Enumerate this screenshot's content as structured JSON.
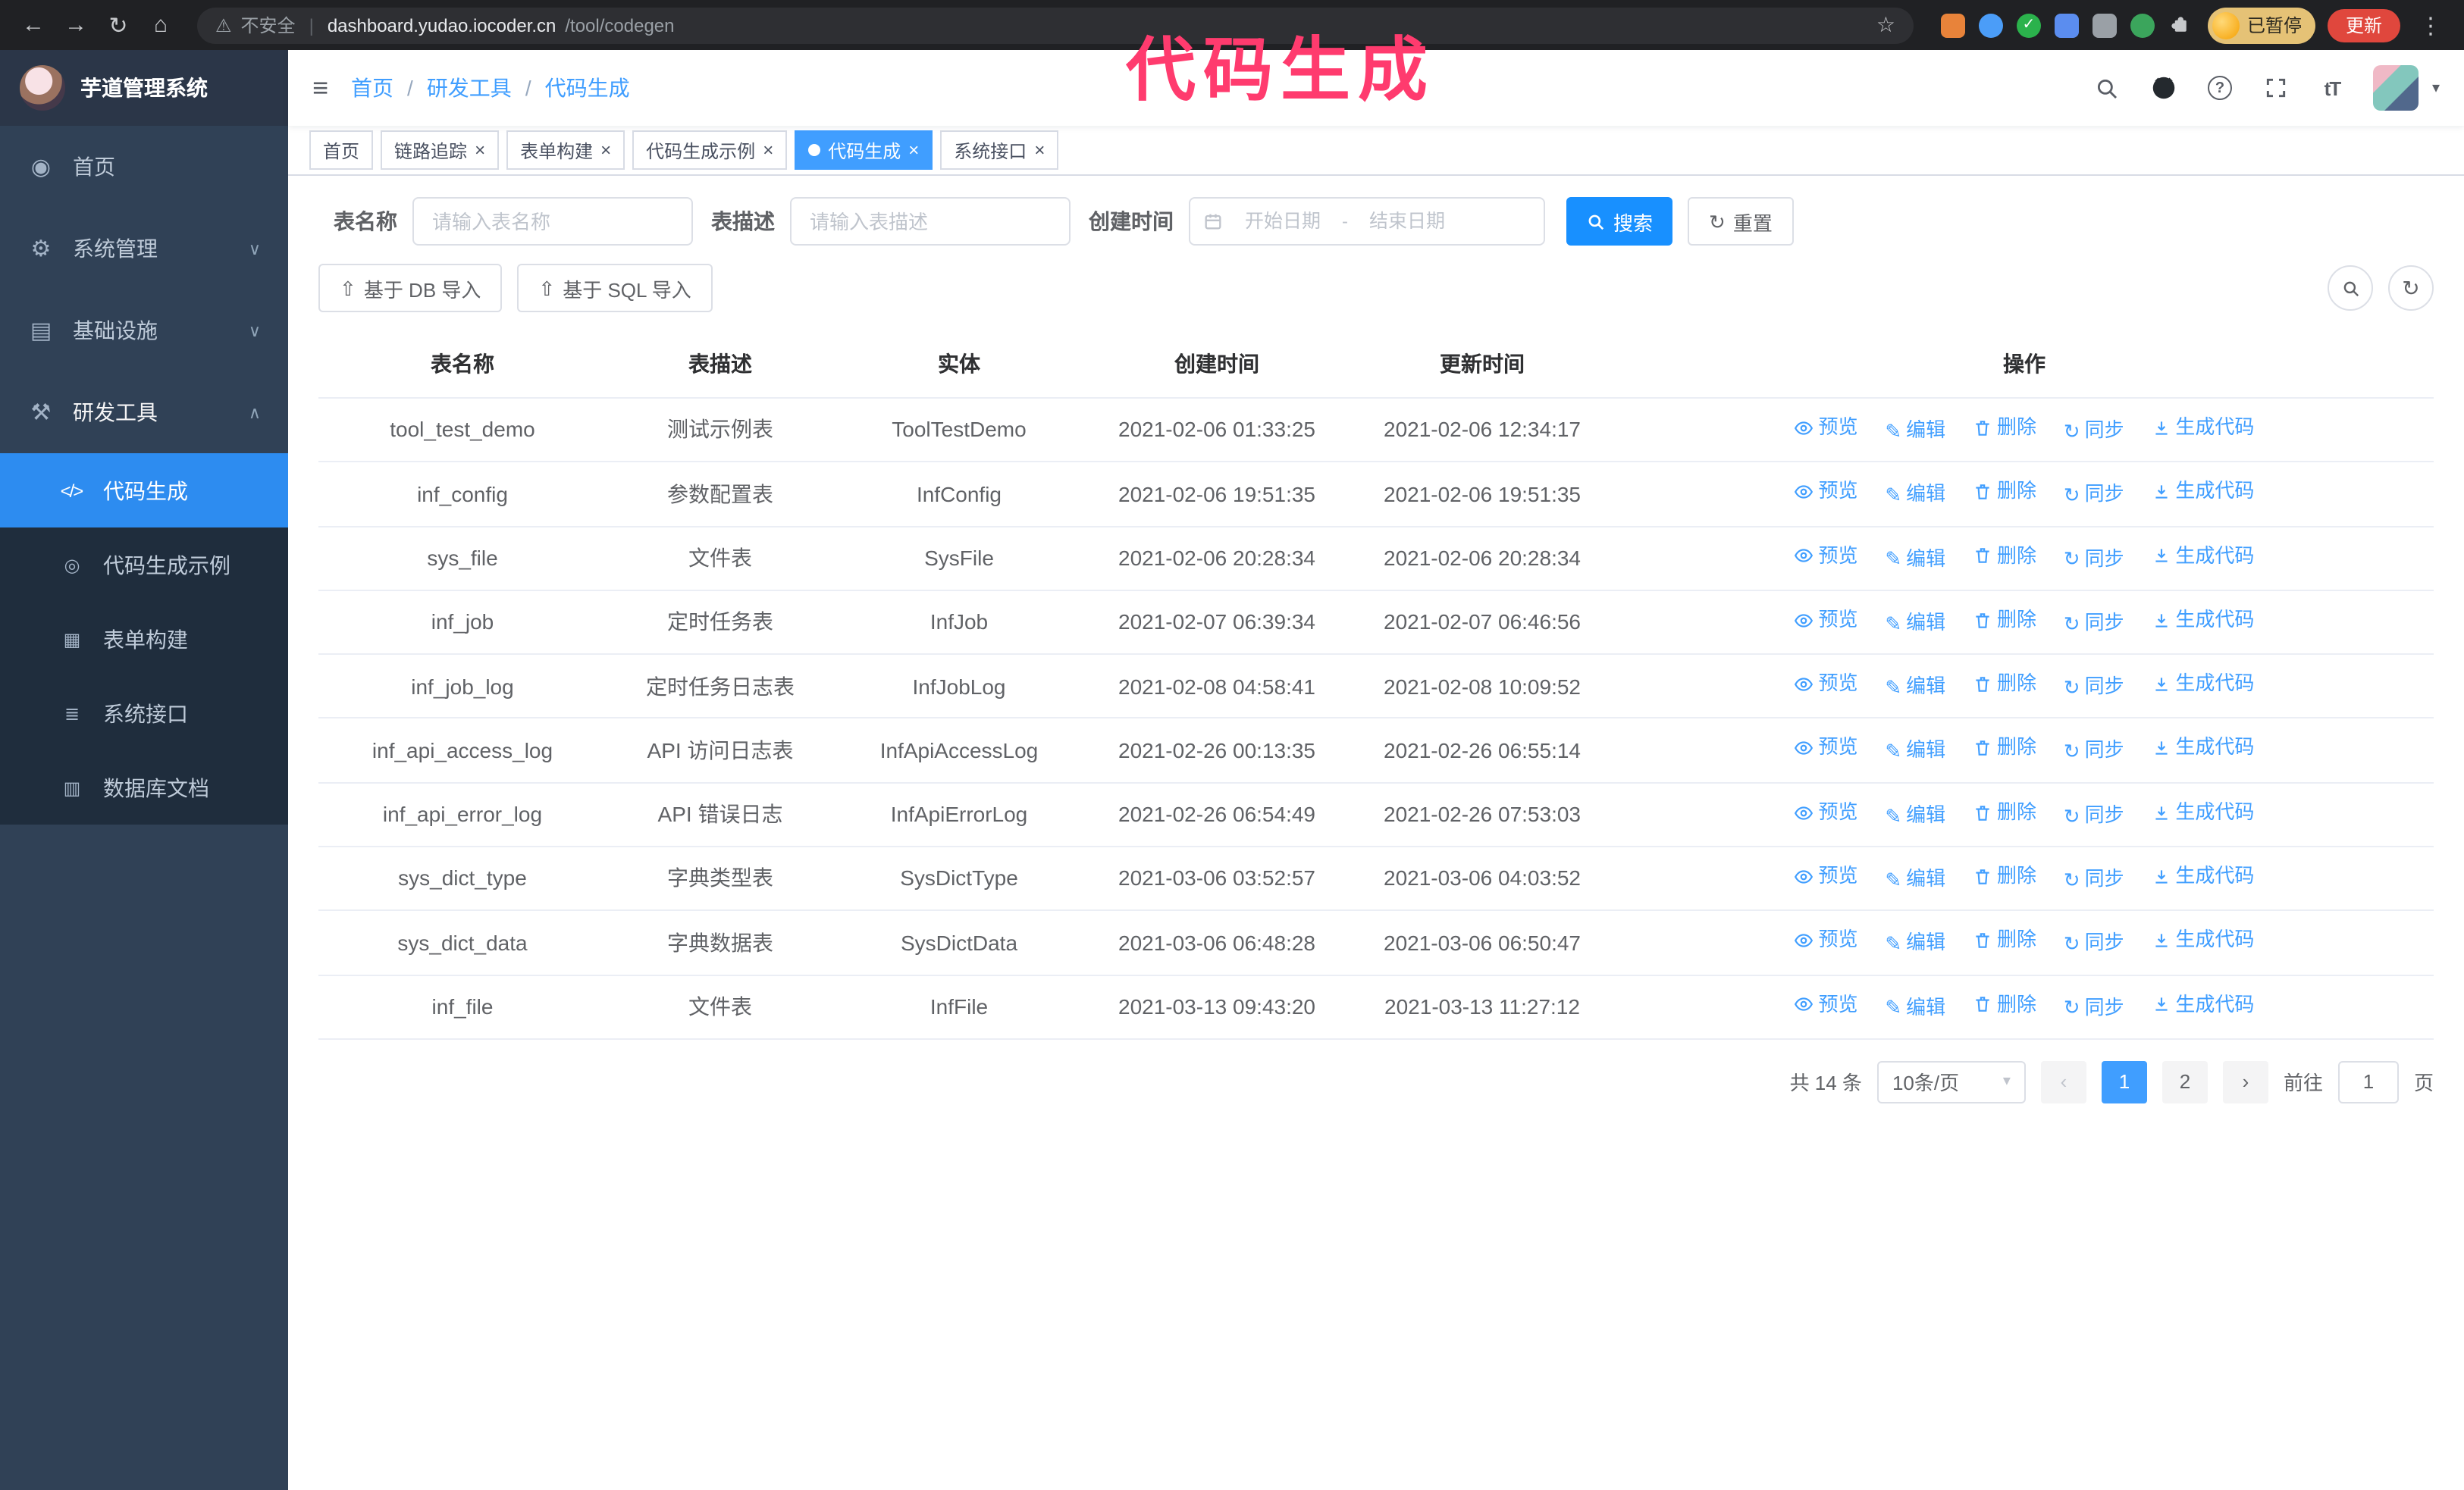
{
  "annotation": {
    "text": "代码生成",
    "color": "#ff3b6e"
  },
  "colors": {
    "accent": "#409eff",
    "primary_button": "#1890ff",
    "sidebar_bg": "#304156",
    "submenu_bg": "#1f2d3d",
    "active_item_bg": "#2d8cf0",
    "update_button_bg": "#e0473d"
  },
  "icons": {
    "back": "←",
    "forward": "→",
    "reload": "↻",
    "home": "⌂",
    "warning": "⚠",
    "star": "☆",
    "overflow": "⋮",
    "check": "✓",
    "dashboard": "◉",
    "gear": "⚙",
    "infrastructure": "▤",
    "tools": "⚒",
    "code": "</>",
    "example": "◎",
    "form_builder": "▦",
    "api": "≣",
    "db_doc": "▥",
    "chevron_down": "∨",
    "chevron_up": "∧",
    "hamburger": "≡",
    "question": "?",
    "font_size": "tT",
    "caret_down": "▾",
    "refresh": "↻",
    "sync": "↻",
    "upload": "⇧",
    "edit": "✎",
    "close": "×",
    "prev": "‹",
    "next": "›",
    "dash": "-"
  },
  "browser": {
    "security_label": "不安全",
    "url_host": "dashboard.yudao.iocoder.cn",
    "url_path": "/tool/codegen",
    "profile_badge": "已暂停",
    "update_button": "更新"
  },
  "sidebar": {
    "logo_title": "芋道管理系统",
    "items": [
      {
        "label": "首页"
      },
      {
        "label": "系统管理"
      },
      {
        "label": "基础设施"
      },
      {
        "label": "研发工具"
      }
    ],
    "submenu": [
      {
        "label": "代码生成"
      },
      {
        "label": "代码生成示例"
      },
      {
        "label": "表单构建"
      },
      {
        "label": "系统接口"
      },
      {
        "label": "数据库文档"
      }
    ]
  },
  "header": {
    "breadcrumb": [
      "首页",
      "研发工具",
      "代码生成"
    ],
    "separator": "/"
  },
  "tabs": [
    {
      "label": "首页"
    },
    {
      "label": "链路追踪"
    },
    {
      "label": "表单构建"
    },
    {
      "label": "代码生成示例"
    },
    {
      "label": "代码生成"
    },
    {
      "label": "系统接口"
    }
  ],
  "filters": {
    "table_name_label": "表名称",
    "table_name_placeholder": "请输入表名称",
    "table_desc_label": "表描述",
    "table_desc_placeholder": "请输入表描述",
    "create_time_label": "创建时间",
    "date_start_placeholder": "开始日期",
    "date_separator": "-",
    "date_end_placeholder": "结束日期",
    "search_button": "搜索",
    "reset_button": "重置"
  },
  "toolbar": {
    "import_db_button": "基于 DB 导入",
    "import_sql_button": "基于 SQL 导入"
  },
  "table": {
    "columns": [
      "表名称",
      "表描述",
      "实体",
      "创建时间",
      "更新时间",
      "操作"
    ],
    "ops": [
      "预览",
      "编辑",
      "删除",
      "同步",
      "生成代码"
    ],
    "rows": [
      {
        "name": "tool_test_demo",
        "desc": "测试示例表",
        "entity": "ToolTestDemo",
        "created": "2021-02-06 01:33:25",
        "updated": "2021-02-06 12:34:17"
      },
      {
        "name": "inf_config",
        "desc": "参数配置表",
        "entity": "InfConfig",
        "created": "2021-02-06 19:51:35",
        "updated": "2021-02-06 19:51:35"
      },
      {
        "name": "sys_file",
        "desc": "文件表",
        "entity": "SysFile",
        "created": "2021-02-06 20:28:34",
        "updated": "2021-02-06 20:28:34"
      },
      {
        "name": "inf_job",
        "desc": "定时任务表",
        "entity": "InfJob",
        "created": "2021-02-07 06:39:34",
        "updated": "2021-02-07 06:46:56"
      },
      {
        "name": "inf_job_log",
        "desc": "定时任务日志表",
        "entity": "InfJobLog",
        "created": "2021-02-08 04:58:41",
        "updated": "2021-02-08 10:09:52"
      },
      {
        "name": "inf_api_access_log",
        "desc": "API 访问日志表",
        "entity": "InfApiAccessLog",
        "created": "2021-02-26 00:13:35",
        "updated": "2021-02-26 06:55:14"
      },
      {
        "name": "inf_api_error_log",
        "desc": "API 错误日志",
        "entity": "InfApiErrorLog",
        "created": "2021-02-26 06:54:49",
        "updated": "2021-02-26 07:53:03"
      },
      {
        "name": "sys_dict_type",
        "desc": "字典类型表",
        "entity": "SysDictType",
        "created": "2021-03-06 03:52:57",
        "updated": "2021-03-06 04:03:52"
      },
      {
        "name": "sys_dict_data",
        "desc": "字典数据表",
        "entity": "SysDictData",
        "created": "2021-03-06 06:48:28",
        "updated": "2021-03-06 06:50:47"
      },
      {
        "name": "inf_file",
        "desc": "文件表",
        "entity": "InfFile",
        "created": "2021-03-13 09:43:20",
        "updated": "2021-03-13 11:27:12"
      }
    ]
  },
  "pagination": {
    "total_label": "共 14 条",
    "page_size_label": "10条/页",
    "pages": [
      "1",
      "2"
    ],
    "active_page": "1",
    "goto_label": "前往",
    "goto_value": "1",
    "goto_suffix": "页"
  }
}
